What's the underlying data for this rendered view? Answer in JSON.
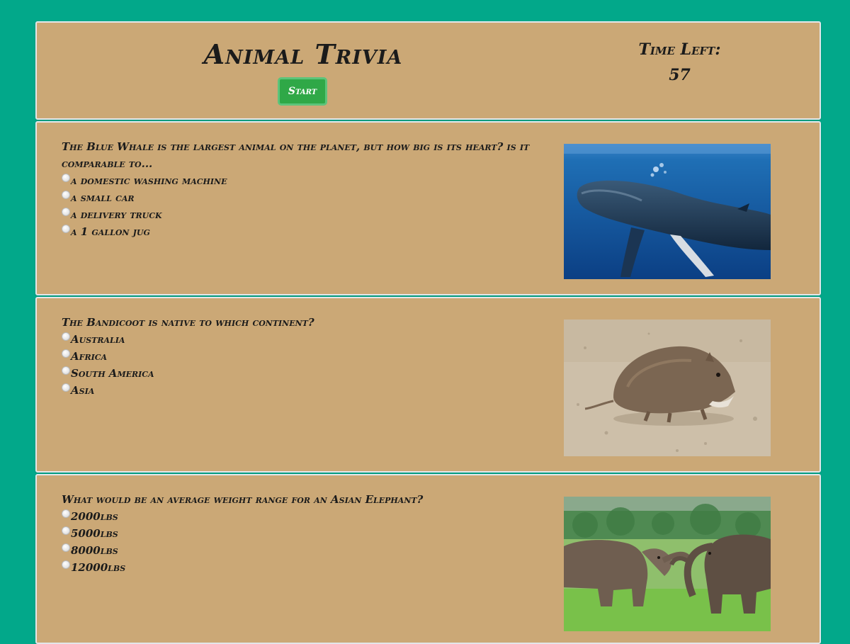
{
  "header": {
    "title": "Animal Trivia",
    "start_label": "Start",
    "time_left_label": "Time Left:",
    "time_left_value": "57"
  },
  "questions": [
    {
      "text": "The Blue Whale is the largest animal on the planet, but how big is its heart? is it comparable to...",
      "options": [
        "a domestic washing machine",
        "a small car",
        "a delivery truck",
        "a 1 gallon jug"
      ],
      "image": "whale-photo"
    },
    {
      "text": "The Bandicoot is native to which continent?",
      "options": [
        "Australia",
        "Africa",
        "South America",
        "Asia"
      ],
      "image": "bandicoot-photo"
    },
    {
      "text": "What would be an average weight range for an Asian Elephant?",
      "options": [
        "2000lbs",
        "5000lbs",
        "8000lbs",
        "12000lbs"
      ],
      "image": "elephants-photo"
    }
  ],
  "colors": {
    "background": "#02a88a",
    "panel": "#cba876",
    "button": "#2fa847"
  }
}
